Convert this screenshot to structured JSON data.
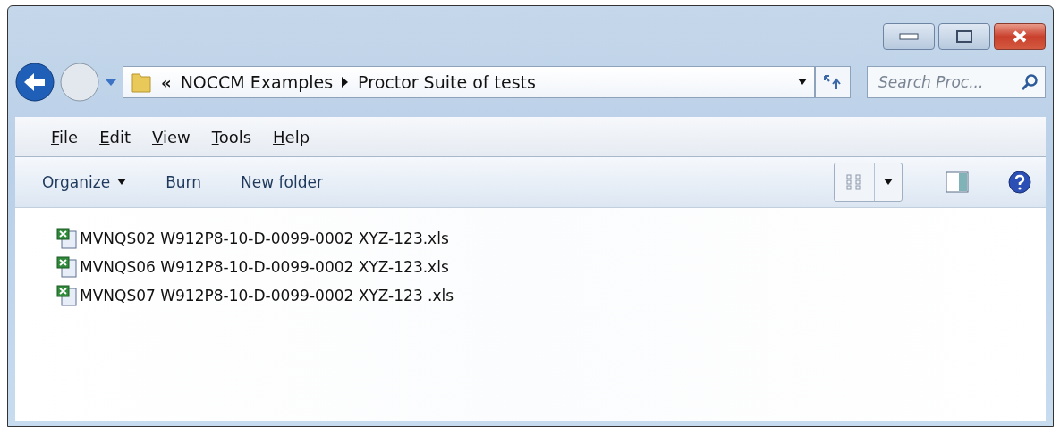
{
  "address_bar": {
    "overflow": "«",
    "path": [
      "NOCCM Examples",
      "Proctor Suite of tests"
    ]
  },
  "search": {
    "placeholder": "Search Proc..."
  },
  "menu_bar": [
    "File",
    "Edit",
    "View",
    "Tools",
    "Help"
  ],
  "toolbar": [
    "Organize",
    "Burn",
    "New folder"
  ],
  "files": [
    {
      "name": "MVNQS02 W912P8-10-D-0099-0002 XYZ-123.xls"
    },
    {
      "name": "MVNQS06 W912P8-10-D-0099-0002 XYZ-123.xls"
    },
    {
      "name": "MVNQS07 W912P8-10-D-0099-0002 XYZ-123 .xls"
    }
  ]
}
